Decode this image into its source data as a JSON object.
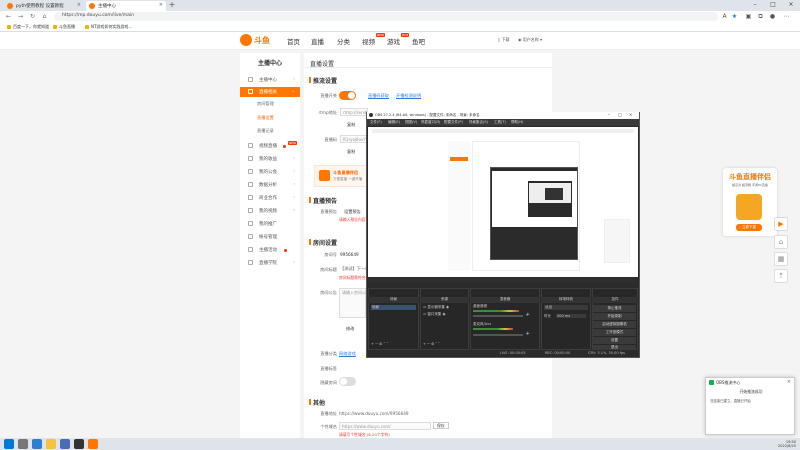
{
  "browser": {
    "tabs": [
      {
        "label": "pyth使用教程 设置教程"
      },
      {
        "label": "主播中心"
      }
    ],
    "url": "https://mp.douyu.com/live/main",
    "bookmarks": [
      "百度一下，你就知道",
      "斗鱼直播",
      "NT游戏如何实践游戏..."
    ]
  },
  "site": {
    "logo": "斗鱼",
    "nav": [
      "首页",
      "直播",
      "分类",
      "视频",
      "游戏",
      "鱼吧"
    ],
    "nav_badges": {
      "video": "NEW",
      "game": "HOT"
    },
    "header_right": [
      "下载",
      "用户名称"
    ]
  },
  "sidebar": {
    "title": "主播中心",
    "items": [
      {
        "label": "主播中心"
      },
      {
        "label": "直播相关",
        "active": true
      },
      {
        "sub": "房间管理"
      },
      {
        "sub": "直播设置",
        "selected": true
      },
      {
        "sub": "直播记录"
      },
      {
        "label": "视频直播",
        "badge": "NEW"
      },
      {
        "label": "我的收益"
      },
      {
        "label": "我的公会"
      },
      {
        "label": "数据分析"
      },
      {
        "label": "商业合作"
      },
      {
        "label": "我的视频"
      },
      {
        "label": "我的推广"
      },
      {
        "label": "帐号管理"
      },
      {
        "label": "主播活动"
      },
      {
        "label": "直播学院"
      }
    ]
  },
  "main": {
    "page_title": "直播设置",
    "sections": {
      "setup": "推流设置",
      "notice": "直播预告",
      "room": "房间设置",
      "other": "其他"
    },
    "fields": {
      "live_switch": "直播开关",
      "rtmp_addr": "rtmp地址",
      "rtmp_value": "rtmp://sendtc3.douyu.com/live",
      "copy": "复制",
      "stream_code": "直播码",
      "stream_value": "ft1ryoj8uv?wsSecret=...",
      "view_link": "直播码获取",
      "bandwidth_link": "开播检测说明",
      "promo_title": "斗鱼直播伴侣",
      "promo_sub": "方便直播 一键开播",
      "notice_label": "直播预告",
      "notice_val": "设置预告",
      "notice_warn": "请输入预告内容",
      "room_id_label": "房间号",
      "room_id": "9956649",
      "room_title_label": "房间标题",
      "room_title_val": "【测试】下一场直播",
      "room_title_warn": "房间标题需符合规范",
      "intro_label": "房间公告",
      "intro_placeholder": "请输入房间公告",
      "modify": "修改",
      "classify_label": "直播分类",
      "classify_val": "网络游戏",
      "tags_label": "直播标签",
      "hide_label": "隐藏房间",
      "other_url_label": "直播地址",
      "other_url": "https://www.douyu.com/9956649",
      "custom_url_label": "个性域名",
      "custom_url_val": "https://www.douyu.com/",
      "save": "保存",
      "custom_warn": "请填写个性域名 (6-20个字符)"
    }
  },
  "obs": {
    "title": "OBS 27.2.4 (64-bit, windows) - 配置文件: 未命名 - 场景: 未命名",
    "menu": [
      "文件(F)",
      "编辑(E)",
      "视图(V)",
      "停靠窗口(D)",
      "配置文件(P)",
      "场景集合(S)",
      "工具(T)",
      "帮助(H)"
    ],
    "docks": {
      "scenes": "场景",
      "scene_item": "场景",
      "sources": "来源",
      "source_items": [
        "显示器采集",
        "窗口采集"
      ],
      "mixer": "混音器",
      "mixer_items": [
        "桌面音频",
        "麦克风/Aux"
      ],
      "transitions": "转场特效",
      "transition_val": "淡出",
      "duration_label": "时长",
      "duration_val": "300 ms",
      "controls": "控件",
      "control_buttons": [
        "停止推流",
        "开始录制",
        "启动虚拟摄像机",
        "工作室模式",
        "设置",
        "退出"
      ]
    },
    "status": [
      "LIVE: 00:00:05",
      "REC: 00:00:00",
      "CPU: 3.1%, 30.00 fps"
    ]
  },
  "ad": {
    "title": "斗鱼直播伴侣",
    "sub": "超高清 超流畅 手游PC直播",
    "button": "立即下载"
  },
  "notification": {
    "app": "OBS推流中心",
    "title": "开始推流成功",
    "body": "流连接已建立，直播已开始"
  },
  "taskbar": {
    "time": "19:50",
    "date": "2022/6/25"
  },
  "colors": {
    "brand": "#ff7700",
    "link": "#2a7ae2",
    "warn": "#ff3333",
    "obs_bg": "#2b2b2b"
  }
}
